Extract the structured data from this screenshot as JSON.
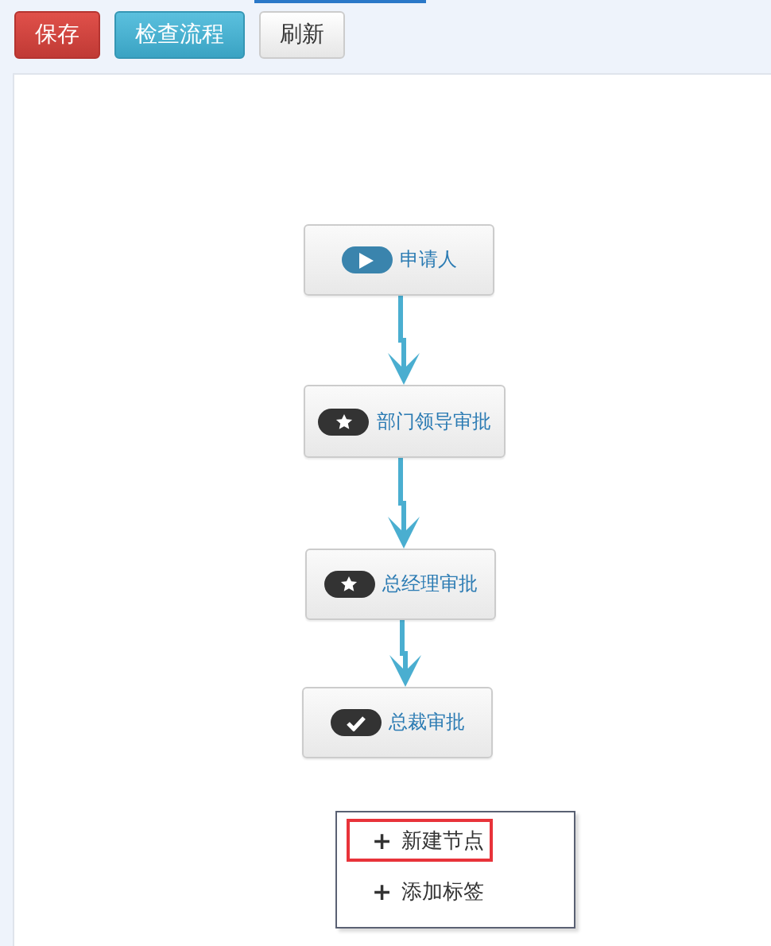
{
  "toolbar": {
    "buttons": [
      {
        "label": "保存",
        "kind": "danger"
      },
      {
        "label": "检查流程",
        "kind": "info"
      },
      {
        "label": "刷新",
        "kind": "default"
      }
    ]
  },
  "flow": {
    "nodes": [
      {
        "label": "申请人",
        "kind": "start"
      },
      {
        "label": "部门领导审批",
        "kind": "approve"
      },
      {
        "label": "总经理审批",
        "kind": "approve"
      },
      {
        "label": "总裁审批",
        "kind": "end"
      }
    ]
  },
  "context_menu": {
    "items": [
      {
        "icon": "+",
        "label": "新建节点",
        "selected": true
      },
      {
        "icon": "+",
        "label": "添加标签",
        "selected": false
      }
    ]
  }
}
